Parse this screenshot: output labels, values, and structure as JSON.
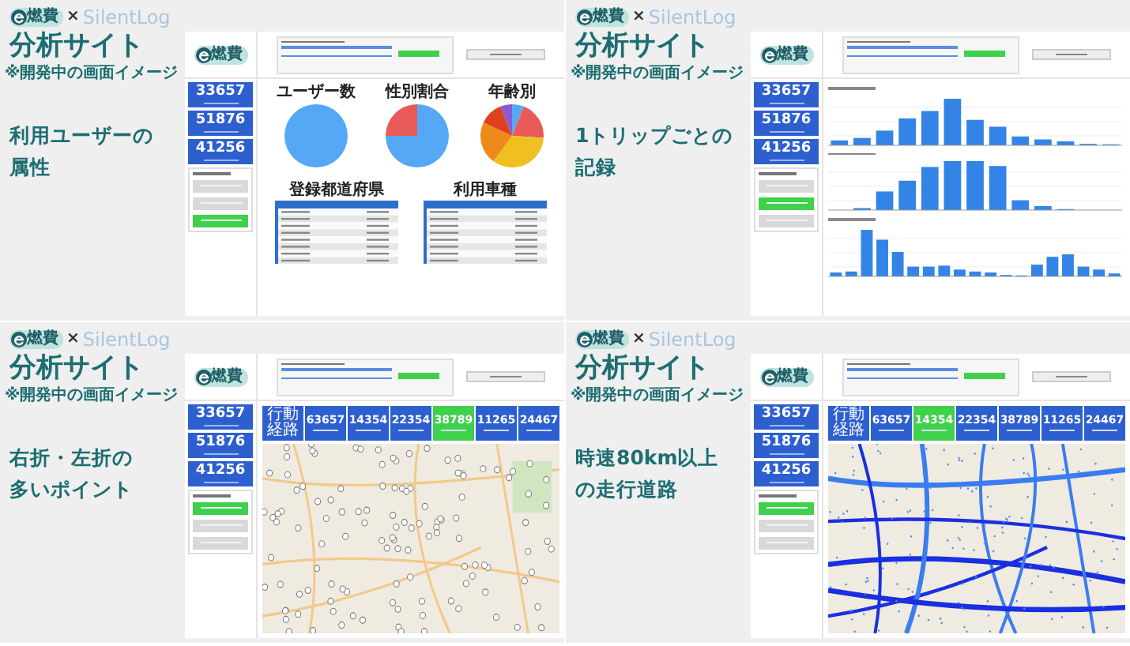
{
  "panels": [
    {
      "brand": {
        "logo_text": "燃費",
        "separator": "×",
        "partner": "SilentLog"
      },
      "title": "分析サイト",
      "subtitle": "※開発中の画面イメージ",
      "caption_lines": [
        "利用ユーザーの",
        "属性"
      ],
      "mockup": {
        "logo_text": "燃費",
        "stats": [
          {
            "value": "33657"
          },
          {
            "value": "51876"
          },
          {
            "value": "41256"
          }
        ],
        "menu": [
          {
            "selected": false
          },
          {
            "selected": false
          },
          {
            "selected": true
          }
        ],
        "content": {
          "kind": "charts",
          "pie_titles": [
            "ユーザー数",
            "性別割合",
            "年齢別"
          ],
          "table_titles": [
            "登録都道府県",
            "利用車種"
          ]
        }
      }
    },
    {
      "brand": {
        "logo_text": "燃費",
        "separator": "×",
        "partner": "SilentLog"
      },
      "title": "分析サイト",
      "subtitle": "※開発中の画面イメージ",
      "caption_lines": [
        "1トリップごとの",
        "記録"
      ],
      "mockup": {
        "logo_text": "燃費",
        "stats": [
          {
            "value": "33657"
          },
          {
            "value": "51876"
          },
          {
            "value": "41256"
          }
        ],
        "menu": [
          {
            "selected": false
          },
          {
            "selected": true
          },
          {
            "selected": false
          }
        ],
        "content": {
          "kind": "bars"
        }
      }
    },
    {
      "brand": {
        "logo_text": "燃費",
        "separator": "×",
        "partner": "SilentLog"
      },
      "title": "分析サイト",
      "subtitle": "※開発中の画面イメージ",
      "caption_lines": [
        "右折・左折の",
        "多いポイント"
      ],
      "mockup": {
        "logo_text": "燃費",
        "stats": [
          {
            "value": "33657"
          },
          {
            "value": "51876"
          },
          {
            "value": "41256"
          }
        ],
        "menu": [
          {
            "selected": true
          },
          {
            "selected": false
          },
          {
            "selected": false
          }
        ],
        "content": {
          "kind": "pointmap",
          "route_label": "行動経路",
          "tiles": [
            {
              "value": "63657",
              "selected": false
            },
            {
              "value": "14354",
              "selected": false
            },
            {
              "value": "22354",
              "selected": false
            },
            {
              "value": "38789",
              "selected": true
            },
            {
              "value": "11265",
              "selected": false
            },
            {
              "value": "24467",
              "selected": false
            }
          ]
        }
      }
    },
    {
      "brand": {
        "logo_text": "燃費",
        "separator": "×",
        "partner": "SilentLog"
      },
      "title": "分析サイト",
      "subtitle": "※開発中の画面イメージ",
      "caption_lines": [
        "時速80km以上",
        "の走行道路"
      ],
      "mockup": {
        "logo_text": "燃費",
        "stats": [
          {
            "value": "33657"
          },
          {
            "value": "51876"
          },
          {
            "value": "41256"
          }
        ],
        "menu": [
          {
            "selected": true
          },
          {
            "selected": false
          },
          {
            "selected": false
          }
        ],
        "content": {
          "kind": "routemap",
          "route_label": "行動経路",
          "tiles": [
            {
              "value": "63657",
              "selected": false
            },
            {
              "value": "14354",
              "selected": true
            },
            {
              "value": "22354",
              "selected": false
            },
            {
              "value": "38789",
              "selected": false
            },
            {
              "value": "11265",
              "selected": false
            },
            {
              "value": "24467",
              "selected": false
            }
          ]
        }
      }
    }
  ]
}
